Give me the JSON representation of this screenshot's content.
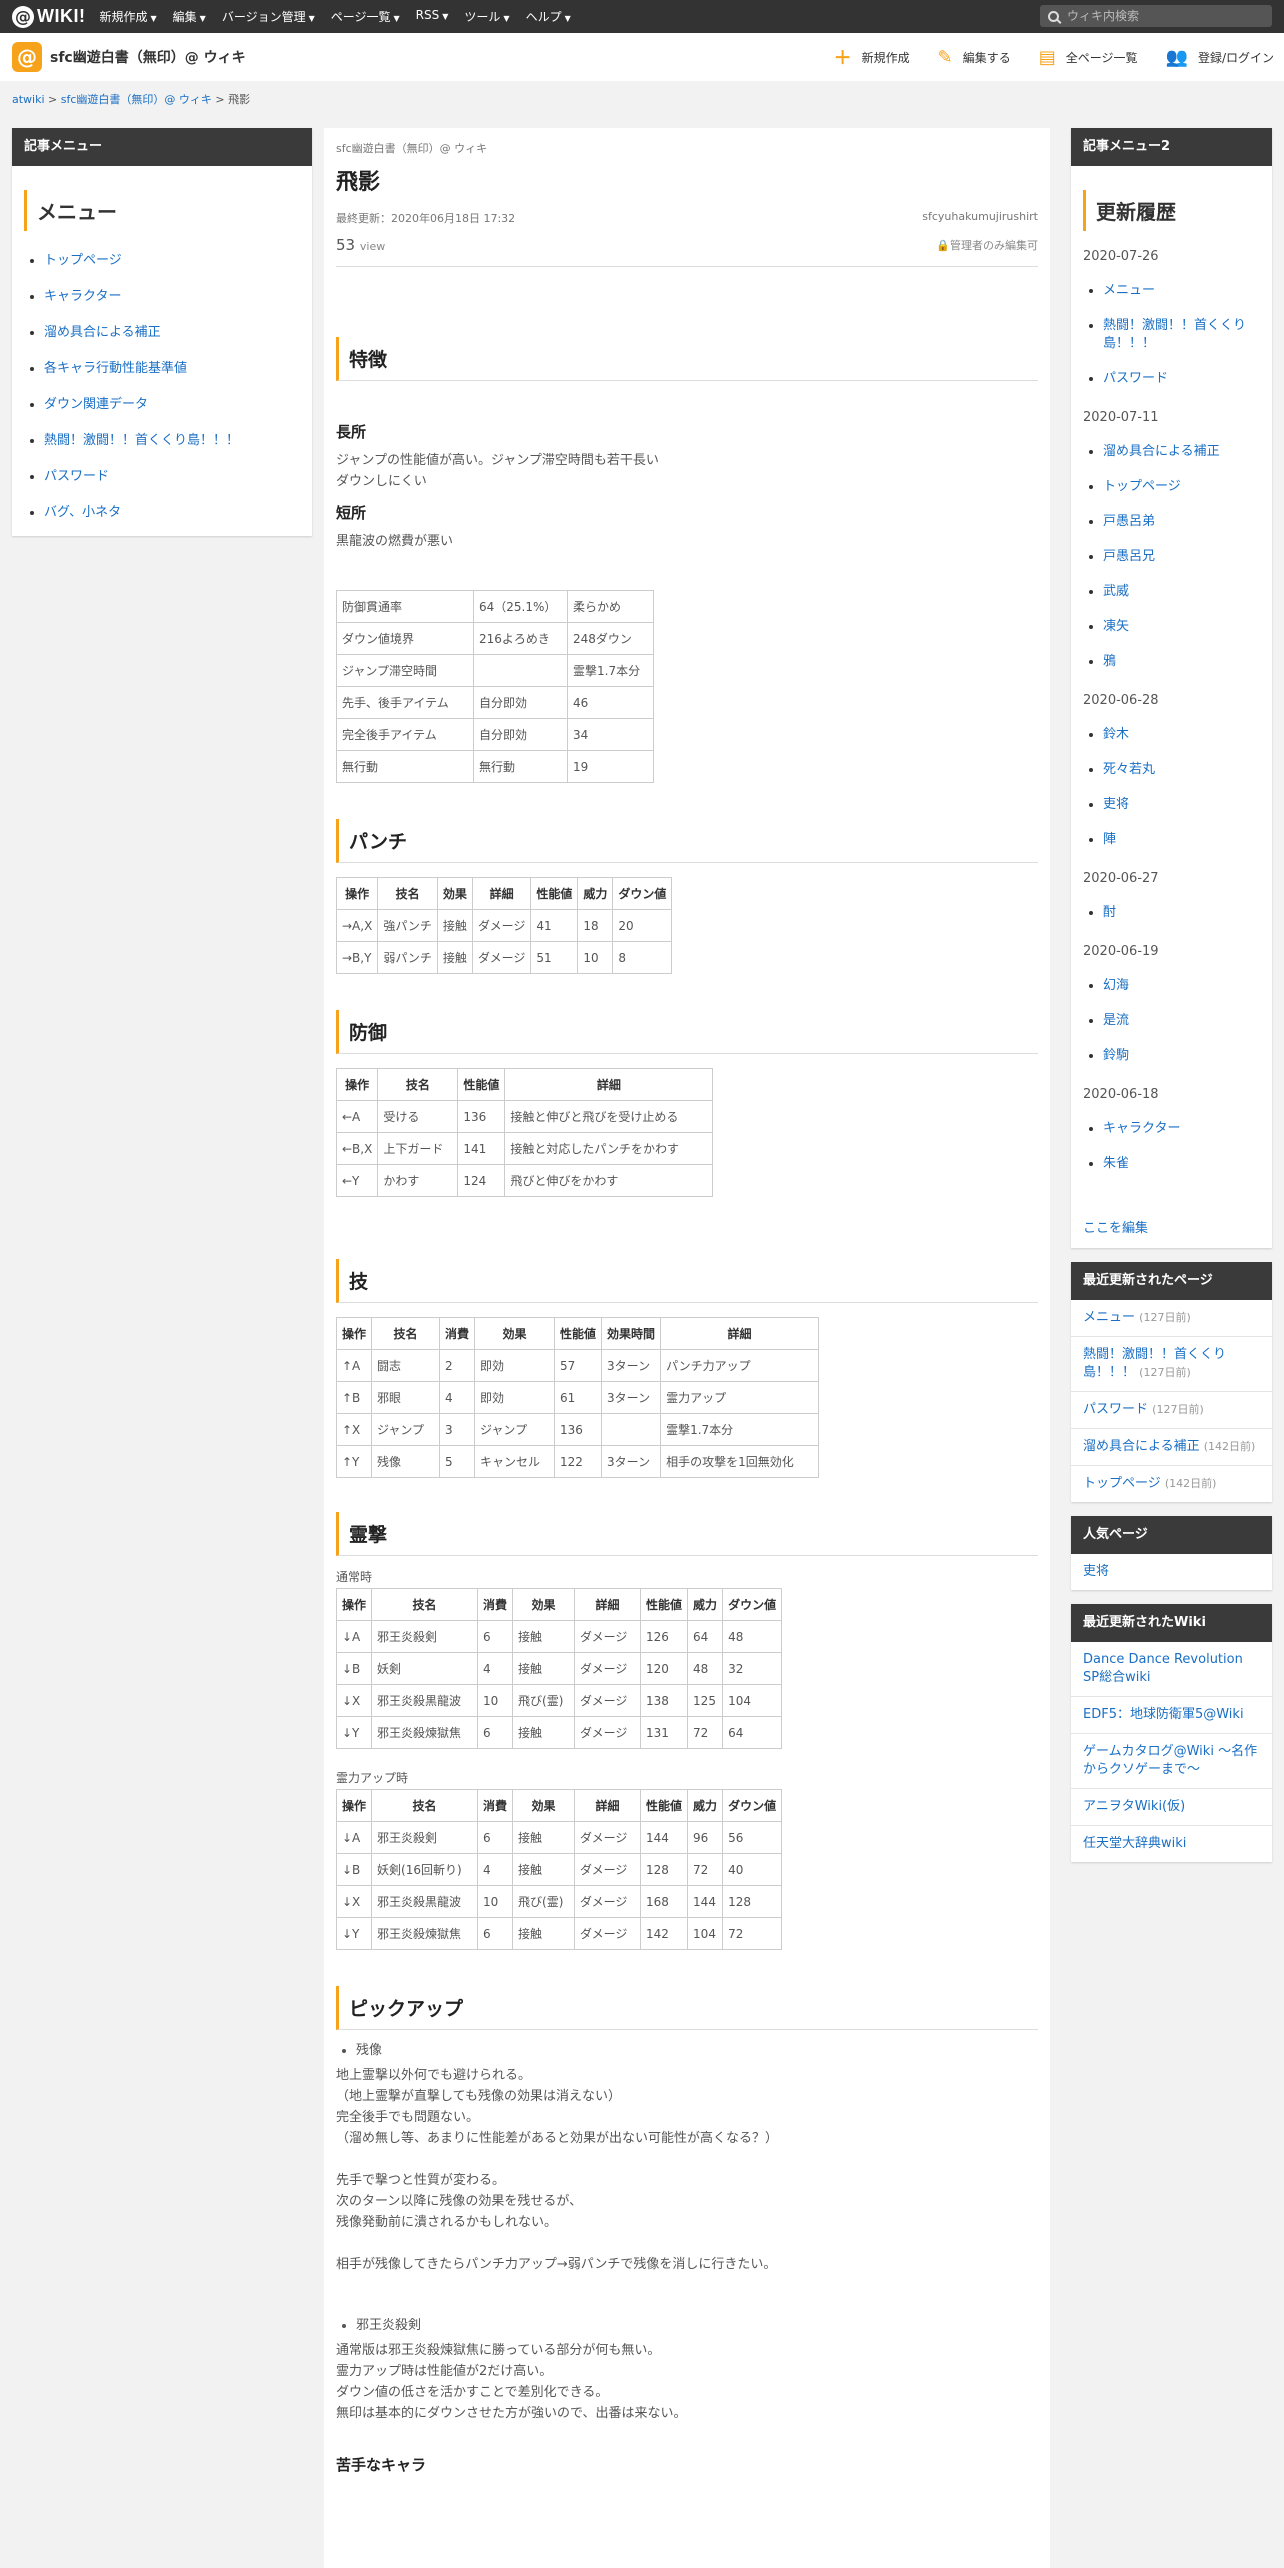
{
  "topbar": {
    "logo_text": "WIKI!",
    "logo_mark": "@",
    "nav": [
      "新規作成",
      "編集",
      "バージョン管理",
      "ページ一覧",
      "RSS",
      "ツール",
      "ヘルプ"
    ],
    "search_placeholder": "ウィキ内検索"
  },
  "header": {
    "site_title": "sfc幽遊白書（無印）@ ウィキ",
    "actions": [
      {
        "label": "新規作成",
        "icon": "plus-icon"
      },
      {
        "label": "編集する",
        "icon": "pencil-icon"
      },
      {
        "label": "全ページ一覧",
        "icon": "document-icon"
      },
      {
        "label": "登録/ログイン",
        "icon": "user-add-icon"
      }
    ]
  },
  "breadcrumb": {
    "root": "atwiki",
    "sep": ">",
    "site": "sfc幽遊白書（無印）@ ウィキ",
    "current": "飛影"
  },
  "left_menu": {
    "title": "記事メニュー",
    "heading": "メニュー",
    "items": [
      "トップページ",
      "キャラクター",
      "溜め具合による補正",
      "各キャラ行動性能基準値",
      "ダウン関連データ",
      "熱闘！激闘！！首くくり島！！！",
      "パスワード",
      "バグ、小ネタ"
    ]
  },
  "article": {
    "site": "sfc幽遊白書（無印）@ ウィキ",
    "title": "飛影",
    "updated": "最終更新：2020年06月18日 17:32",
    "author": "sfcyuhakumujirushirt",
    "views": "53",
    "views_unit": "view",
    "lock_text": "管理者のみ編集可",
    "sections": {
      "traits": "特徴",
      "merit_h": "長所",
      "merit_lines": [
        "ジャンプの性能値が高い。ジャンプ滞空時間も若干長い",
        "ダウンしにくい"
      ],
      "demerit_h": "短所",
      "demerit_lines": [
        "黒龍波の燃費が悪い"
      ],
      "punch": "パンチ",
      "guard": "防御",
      "skill": "技",
      "reigeki": "霊撃",
      "reigeki_normal": "通常時",
      "reigeki_up": "霊力アップ時",
      "pickup": "ピックアップ",
      "weak": "苦手なキャラ"
    },
    "stats_table": [
      [
        "防御貫通率",
        "64（25.1%）",
        "柔らかめ"
      ],
      [
        "ダウン値境界",
        "216よろめき",
        "248ダウン"
      ],
      [
        "ジャンプ滞空時間",
        "",
        "霊撃1.7本分"
      ],
      [
        "先手、後手アイテム",
        "自分即効",
        "46"
      ],
      [
        "完全後手アイテム",
        "自分即効",
        "34"
      ],
      [
        "無行動",
        "無行動",
        "19"
      ]
    ],
    "punch_table": {
      "headers": [
        "操作",
        "技名",
        "効果",
        "詳細",
        "性能値",
        "威力",
        "ダウン値"
      ],
      "rows": [
        [
          "→A,X",
          "強パンチ",
          "接触",
          "ダメージ",
          "41",
          "18",
          "20"
        ],
        [
          "→B,Y",
          "弱パンチ",
          "接触",
          "ダメージ",
          "51",
          "10",
          "8"
        ]
      ]
    },
    "guard_table": {
      "headers": [
        "操作",
        "技名",
        "性能値",
        "詳細"
      ],
      "rows": [
        [
          "←A",
          "受ける",
          "136",
          "接触と伸びと飛びを受け止める"
        ],
        [
          "←B,X",
          "上下ガード",
          "141",
          "接触と対応したパンチをかわす"
        ],
        [
          "←Y",
          "かわす",
          "124",
          "飛びと伸びをかわす"
        ]
      ]
    },
    "skill_table": {
      "headers": [
        "操作",
        "技名",
        "消費",
        "効果",
        "性能値",
        "効果時間",
        "詳細"
      ],
      "rows": [
        [
          "↑A",
          "闘志",
          "2",
          "即効",
          "57",
          "3ターン",
          "パンチ力アップ"
        ],
        [
          "↑B",
          "邪眼",
          "4",
          "即効",
          "61",
          "3ターン",
          "霊力アップ"
        ],
        [
          "↑X",
          "ジャンプ",
          "3",
          "ジャンプ",
          "136",
          "",
          "霊撃1.7本分"
        ],
        [
          "↑Y",
          "残像",
          "5",
          "キャンセル",
          "122",
          "3ターン",
          "相手の攻撃を1回無効化"
        ]
      ]
    },
    "reigeki_normal_table": {
      "headers": [
        "操作",
        "技名",
        "消費",
        "効果",
        "詳細",
        "性能値",
        "威力",
        "ダウン値"
      ],
      "rows": [
        [
          "↓A",
          "邪王炎殺剣",
          "6",
          "接触",
          "ダメージ",
          "126",
          "64",
          "48"
        ],
        [
          "↓B",
          "妖剣",
          "4",
          "接触",
          "ダメージ",
          "120",
          "48",
          "32"
        ],
        [
          "↓X",
          "邪王炎殺黒龍波",
          "10",
          "飛び(霊)",
          "ダメージ",
          "138",
          "125",
          "104"
        ],
        [
          "↓Y",
          "邪王炎殺煉獄焦",
          "6",
          "接触",
          "ダメージ",
          "131",
          "72",
          "64"
        ]
      ]
    },
    "reigeki_up_table": {
      "headers": [
        "操作",
        "技名",
        "消費",
        "効果",
        "詳細",
        "性能値",
        "威力",
        "ダウン値"
      ],
      "rows": [
        [
          "↓A",
          "邪王炎殺剣",
          "6",
          "接触",
          "ダメージ",
          "144",
          "96",
          "56"
        ],
        [
          "↓B",
          "妖剣(16回斬り)",
          "4",
          "接触",
          "ダメージ",
          "128",
          "72",
          "40"
        ],
        [
          "↓X",
          "邪王炎殺黒龍波",
          "10",
          "飛び(霊)",
          "ダメージ",
          "168",
          "144",
          "128"
        ],
        [
          "↓Y",
          "邪王炎殺煉獄焦",
          "6",
          "接触",
          "ダメージ",
          "142",
          "104",
          "72"
        ]
      ]
    },
    "pickup1_title": "残像",
    "pickup1_lines": [
      "地上霊撃以外何でも避けられる。",
      "（地上霊撃が直撃しても残像の効果は消えない）",
      "完全後手でも問題ない。",
      "（溜め無し等、あまりに性能差があると効果が出ない可能性が高くなる？）",
      "",
      "先手で撃つと性質が変わる。",
      "次のターン以降に残像の効果を残せるが、",
      "残像発動前に潰されるかもしれない。",
      "",
      "相手が残像してきたらパンチ力アップ→弱パンチで残像を消しに行きたい。"
    ],
    "pickup2_title": "邪王炎殺剣",
    "pickup2_lines": [
      "通常版は邪王炎殺煉獄焦に勝っている部分が何も無い。",
      "霊力アップ時は性能値が2だけ高い。",
      "ダウン値の低さを活かすことで差別化できる。",
      "無印は基本的にダウンさせた方が強いので、出番は来ない。"
    ]
  },
  "right": {
    "menu2_title": "記事メニュー2",
    "history_heading": "更新履歴",
    "history": [
      {
        "date": "2020-07-26",
        "items": [
          "メニュー",
          "熱闘！激闘！！首くくり島！！！",
          "パスワード"
        ]
      },
      {
        "date": "2020-07-11",
        "items": [
          "溜め具合による補正",
          "トップページ",
          "戸愚呂弟",
          "戸愚呂兄",
          "武威",
          "凍矢",
          "鴉"
        ]
      },
      {
        "date": "2020-06-28",
        "items": [
          "鈴木",
          "死々若丸",
          "吏将",
          "陣"
        ]
      },
      {
        "date": "2020-06-27",
        "items": [
          "酎"
        ]
      },
      {
        "date": "2020-06-19",
        "items": [
          "幻海",
          "是流",
          "鈴駒"
        ]
      },
      {
        "date": "2020-06-18",
        "items": [
          "キャラクター",
          "朱雀"
        ]
      }
    ],
    "edit_link": "ここを編集",
    "recent_title": "最近更新されたページ",
    "recent": [
      {
        "name": "メニュー",
        "ago": "(127日前)"
      },
      {
        "name": "熱闘！激闘！！首くくり島！！！",
        "ago": "(127日前)"
      },
      {
        "name": "パスワード",
        "ago": "(127日前)"
      },
      {
        "name": "溜め具合による補正",
        "ago": "(142日前)"
      },
      {
        "name": "トップページ",
        "ago": "(142日前)"
      }
    ],
    "popular_title": "人気ページ",
    "popular": [
      "吏将"
    ],
    "wiki_title": "最近更新されたWiki",
    "wikis": [
      "Dance Dance Revolution SP総合wiki",
      "EDF5：地球防衛軍5@Wiki",
      "ゲームカタログ@Wiki ～名作からクソゲーまで～",
      "アニヲタWiki(仮)",
      "任天堂大辞典wiki"
    ]
  }
}
